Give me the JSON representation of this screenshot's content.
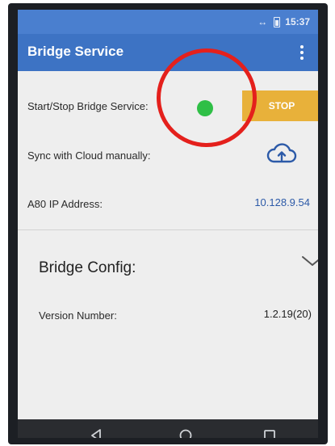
{
  "status_bar": {
    "time": "15:37",
    "arrows_glyph": "↔"
  },
  "app_bar": {
    "title": "Bridge Service",
    "menu_icon": "more-vertical-icon"
  },
  "rows": {
    "start_stop": {
      "label": "Start/Stop Bridge Service:",
      "button_label": "STOP",
      "status_color": "#2fbf46"
    },
    "sync": {
      "label": "Sync with Cloud manually:",
      "icon": "cloud-upload-icon"
    },
    "ip": {
      "label": "A80 IP Address:",
      "value": "10.128.9.54"
    }
  },
  "config": {
    "title": "Bridge Config:",
    "chevron_icon": "chevron-down-icon",
    "version_label": "Version Number:",
    "version_value": "1.2.19(20)"
  },
  "nav": {
    "back_icon": "back-triangle-icon",
    "home_icon": "home-circle-icon",
    "recents_icon": "recents-square-icon"
  },
  "colors": {
    "app_bar": "#3d73c4",
    "stop_button": "#e8b13a",
    "ip_text": "#2c5aa8",
    "annotation": "#e4201c"
  }
}
